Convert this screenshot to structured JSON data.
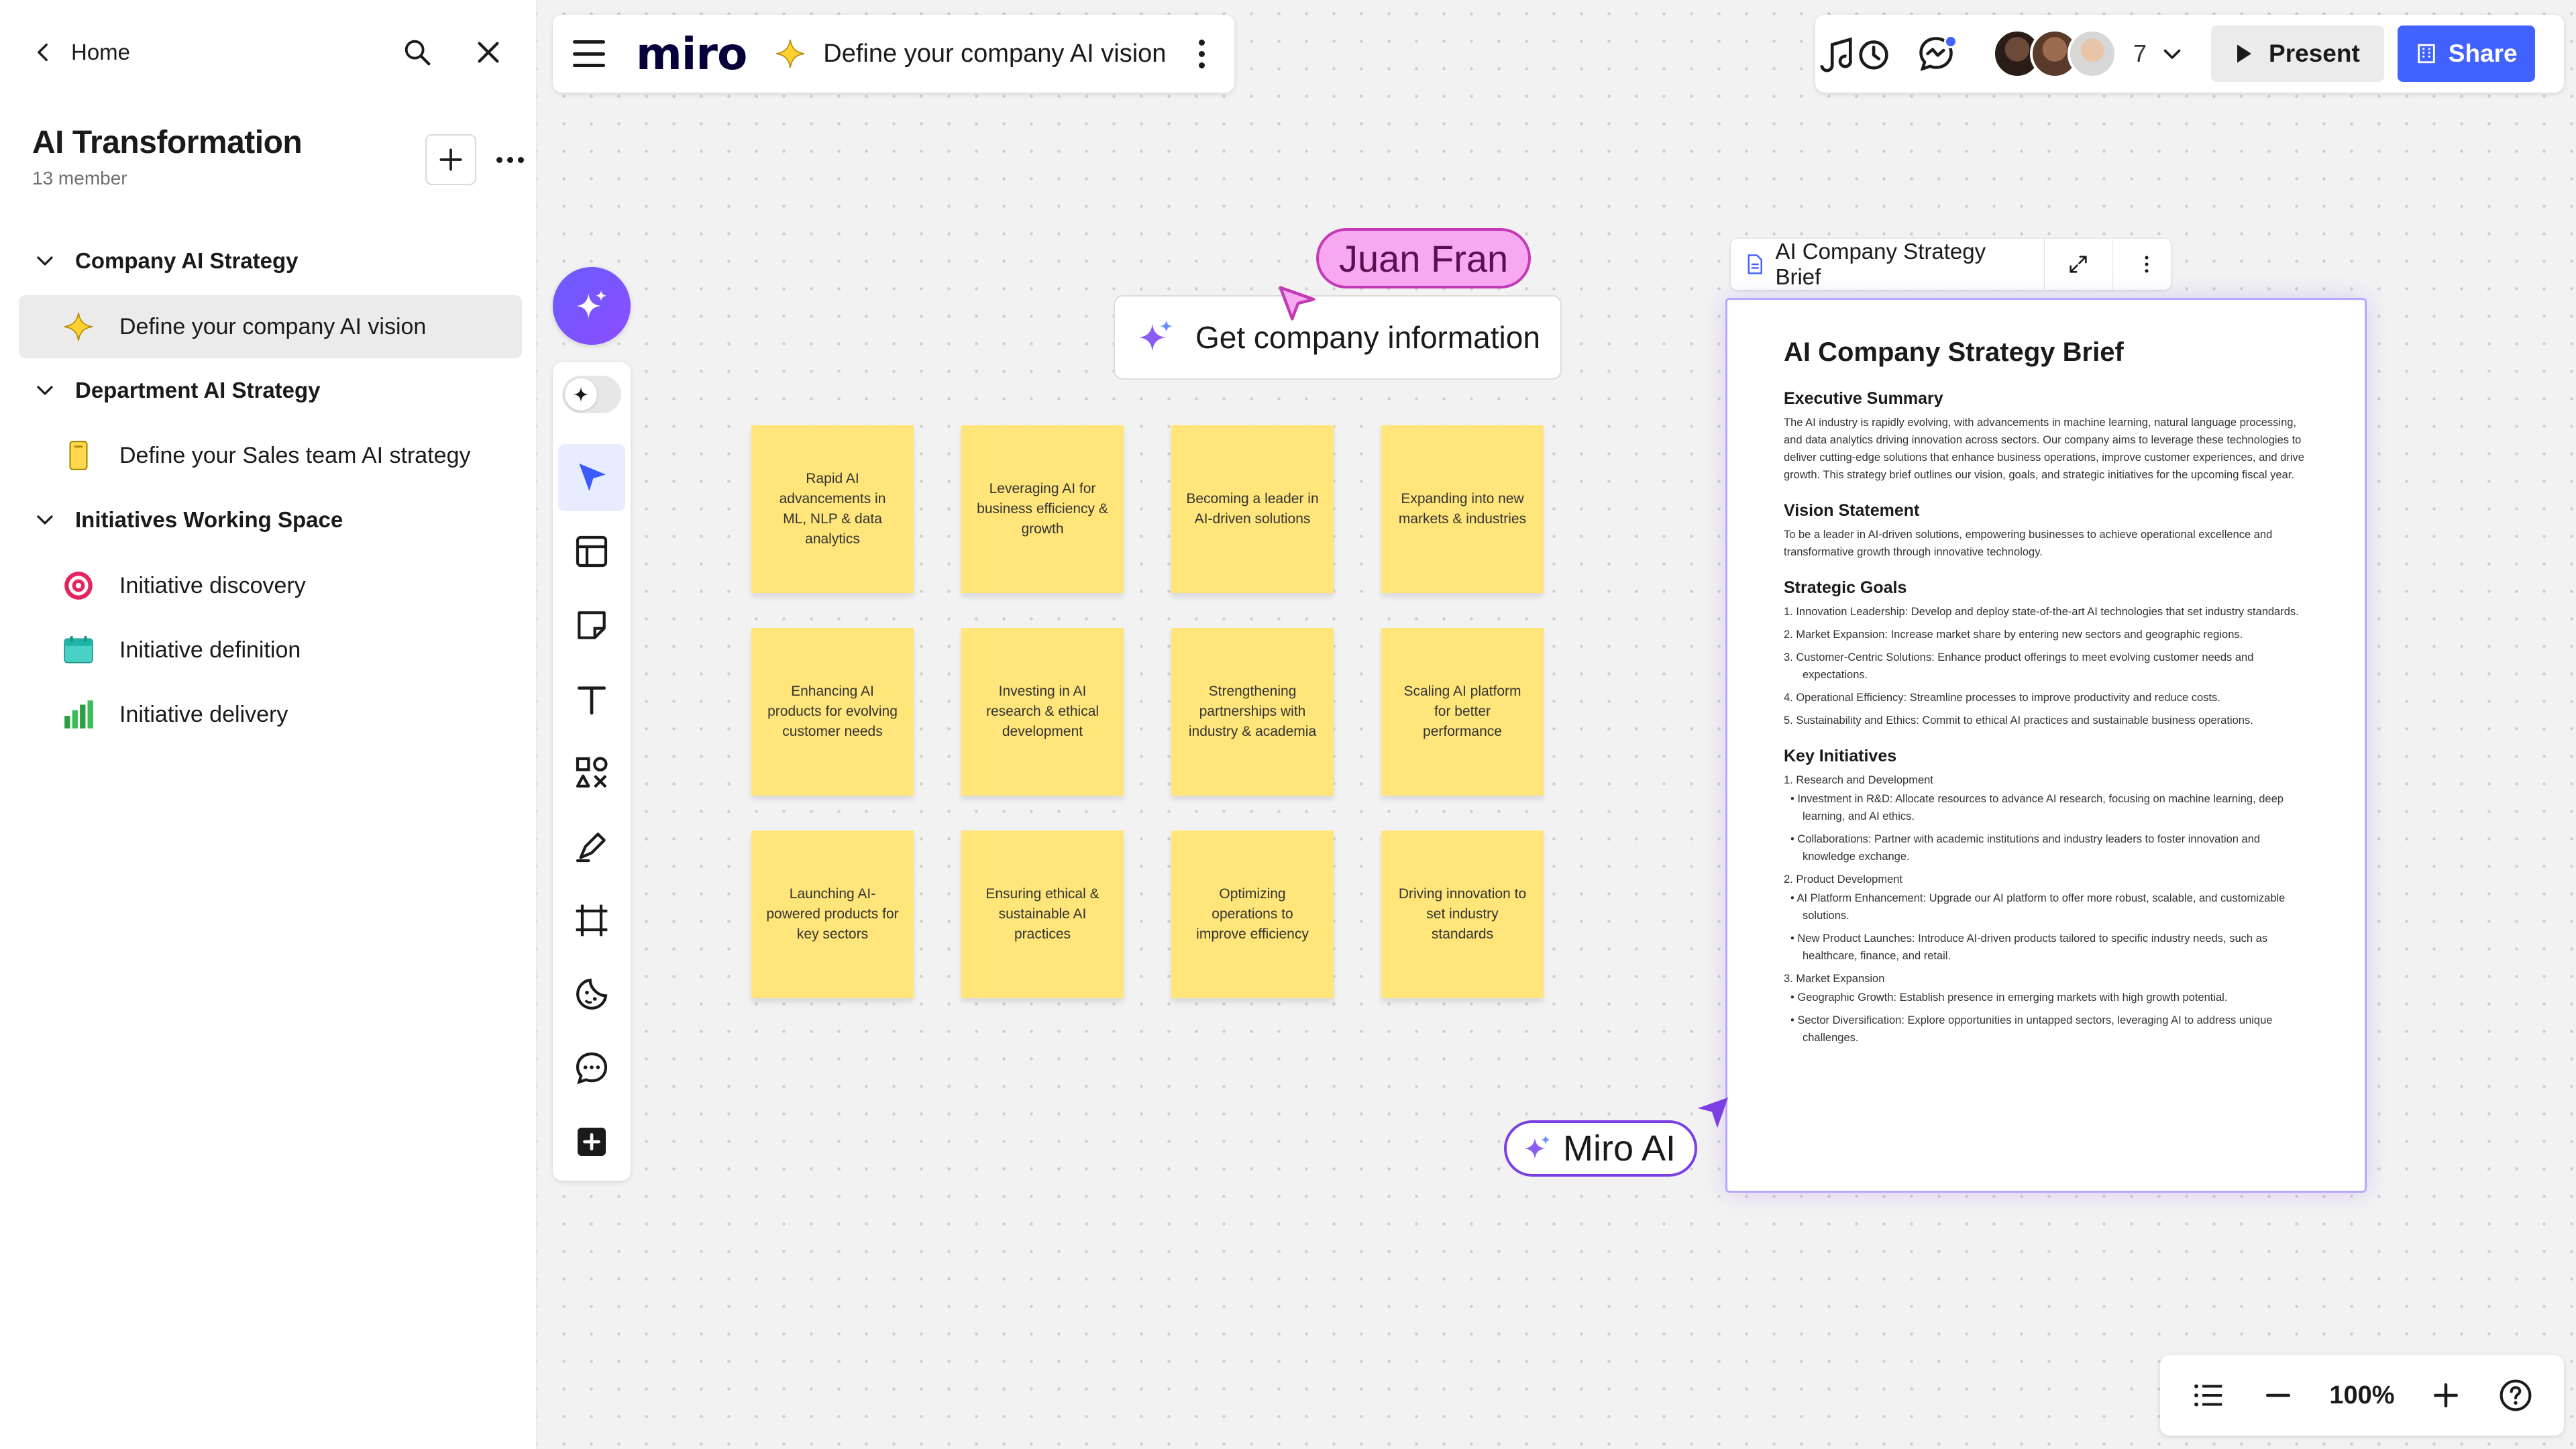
{
  "sidebar": {
    "home_label": "Home",
    "team_name": "AI Transformation",
    "member_count": "13 member",
    "sections": [
      {
        "title": "Company AI Strategy",
        "items": [
          {
            "label": "Define your company AI vision",
            "icon": "star-icon",
            "active": true
          }
        ]
      },
      {
        "title": "Department AI Strategy",
        "items": [
          {
            "label": "Define your Sales team AI strategy",
            "icon": "sticky-note-icon"
          }
        ]
      },
      {
        "title": "Initiatives Working Space",
        "items": [
          {
            "label": "Initiative discovery",
            "icon": "target-icon"
          },
          {
            "label": "Initiative definition",
            "icon": "calendar-icon"
          },
          {
            "label": "Initiative delivery",
            "icon": "bar-chart-icon"
          }
        ]
      }
    ]
  },
  "boardbar": {
    "logo": "miro",
    "board_title": "Define your company AI vision"
  },
  "topbar": {
    "collaborator_count": "7",
    "present_label": "Present",
    "share_label": "Share",
    "accent": "#4262ff"
  },
  "canvas": {
    "get_info_label": "Get company information",
    "cursor_user": "Juan Fran",
    "ai_tag": "Miro AI",
    "stickies": [
      "Rapid AI advancements in ML, NLP & data analytics",
      "Leveraging AI for business efficiency & growth",
      "Becoming a leader in AI-driven solutions",
      "Expanding into new markets & industries",
      "Enhancing AI products for evolving customer needs",
      "Investing in AI research & ethical development",
      "Strengthening partnerships with industry & academia",
      "Scaling AI platform for better performance",
      "Launching AI-powered products for key sectors",
      "Ensuring ethical & sustainable AI practices",
      "Optimizing operations to improve efficiency",
      "Driving innovation to set industry standards"
    ],
    "sticky_color": "#ffe57a"
  },
  "doc": {
    "header_title": "AI Company Strategy Brief",
    "title": "AI Company Strategy Brief",
    "exec_heading": "Executive Summary",
    "exec_text": "The AI industry is rapidly evolving, with advancements in machine learning, natural language processing, and data analytics driving innovation across sectors. Our company aims to leverage these technologies to deliver cutting-edge solutions that enhance business operations, improve customer experiences, and drive growth. This strategy brief outlines our vision, goals, and strategic initiatives for the upcoming fiscal year.",
    "vision_heading": "Vision Statement",
    "vision_text": "To be a leader in AI-driven solutions, empowering businesses to achieve operational excellence and transformative growth through innovative technology.",
    "goals_heading": "Strategic Goals",
    "goals": [
      "1. Innovation Leadership: Develop and deploy state-of-the-art AI technologies that set industry standards.",
      "2. Market Expansion: Increase market share by entering new sectors and geographic regions.",
      "3. Customer-Centric Solutions: Enhance product offerings to meet evolving customer needs and expectations.",
      "4. Operational Efficiency: Streamline processes to improve productivity and reduce costs.",
      "5. Sustainability and Ethics: Commit to ethical AI practices and sustainable business operations."
    ],
    "initiatives_heading": "Key Initiatives",
    "initiatives": [
      {
        "title": "1. Research and Development",
        "points": [
          "• Investment in R&D: Allocate resources to advance AI research, focusing on machine learning, deep learning, and AI ethics.",
          "• Collaborations: Partner with academic institutions and industry leaders to foster innovation and knowledge exchange."
        ]
      },
      {
        "title": "2. Product Development",
        "points": [
          "• AI Platform Enhancement: Upgrade our AI platform to offer more robust, scalable, and customizable solutions.",
          "• New Product Launches: Introduce AI-driven products tailored to specific industry needs, such as healthcare, finance, and retail."
        ]
      },
      {
        "title": "3. Market Expansion",
        "points": [
          "• Geographic Growth: Establish presence in emerging markets with high growth potential.",
          "• Sector Diversification: Explore opportunities in untapped sectors, leveraging AI to address unique challenges."
        ]
      }
    ]
  },
  "zoom": {
    "level": "100%"
  }
}
